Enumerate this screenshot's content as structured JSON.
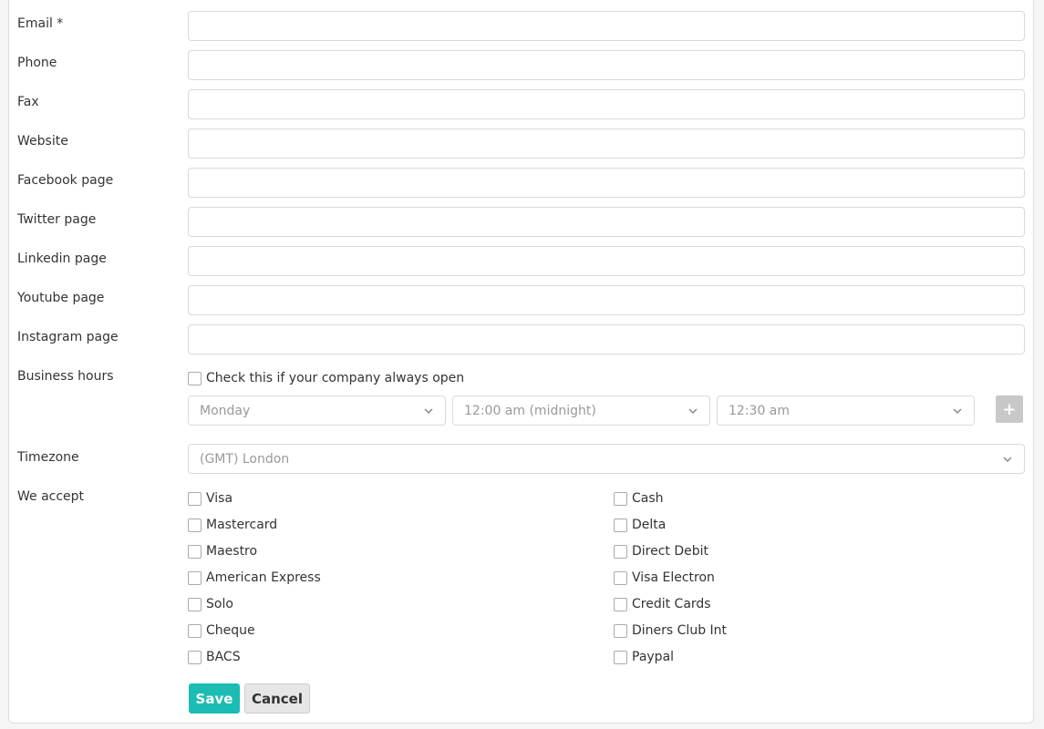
{
  "fields": [
    {
      "label": "Email *",
      "value": ""
    },
    {
      "label": "Phone",
      "value": ""
    },
    {
      "label": "Fax",
      "value": ""
    },
    {
      "label": "Website",
      "value": ""
    },
    {
      "label": "Facebook page",
      "value": ""
    },
    {
      "label": "Twitter page",
      "value": ""
    },
    {
      "label": "Linkedin page",
      "value": ""
    },
    {
      "label": "Youtube page",
      "value": ""
    },
    {
      "label": "Instagram page",
      "value": ""
    }
  ],
  "business_hours": {
    "label": "Business hours",
    "always_open_label": "Check this if your company always open",
    "always_open_checked": false,
    "day": "Monday",
    "open_time": "12:00 am (midnight)",
    "close_time": "12:30 am",
    "add_label": "+"
  },
  "timezone": {
    "label": "Timezone",
    "value": "(GMT) London"
  },
  "we_accept": {
    "label": "We accept",
    "left": [
      {
        "label": "Visa",
        "checked": false
      },
      {
        "label": "Mastercard",
        "checked": false
      },
      {
        "label": "Maestro",
        "checked": false
      },
      {
        "label": "American Express",
        "checked": false
      },
      {
        "label": "Solo",
        "checked": false
      },
      {
        "label": "Cheque",
        "checked": false
      },
      {
        "label": "BACS",
        "checked": false
      }
    ],
    "right": [
      {
        "label": "Cash",
        "checked": false
      },
      {
        "label": "Delta",
        "checked": false
      },
      {
        "label": "Direct Debit",
        "checked": false
      },
      {
        "label": "Visa Electron",
        "checked": false
      },
      {
        "label": "Credit Cards",
        "checked": false
      },
      {
        "label": "Diners Club Int",
        "checked": false
      },
      {
        "label": "Paypal",
        "checked": false
      }
    ]
  },
  "actions": {
    "save": "Save",
    "cancel": "Cancel"
  },
  "colors": {
    "primary": "#1abcb3",
    "add_button": "#c8c8c8"
  }
}
